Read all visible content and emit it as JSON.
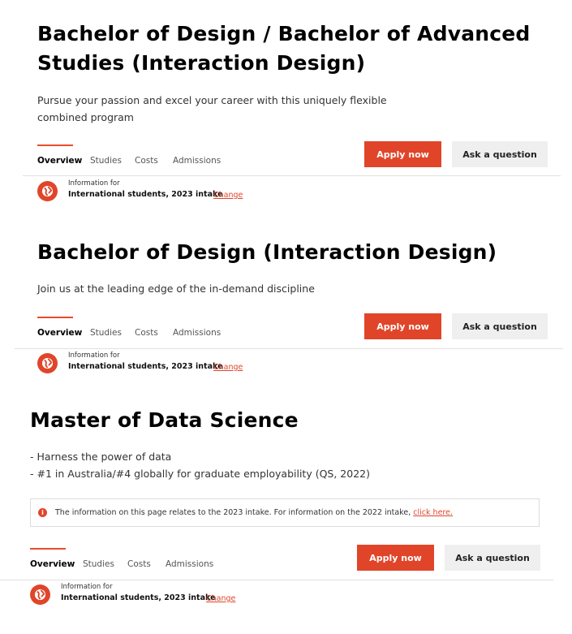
{
  "programs": [
    {
      "title_line1": "Bachelor of Design / Bachelor of Advanced",
      "title_line2": "Studies (Interaction Design)",
      "subtitle_line1": "Pursue your passion and excel your career with this uniquely flexible",
      "subtitle_line2": "combined program",
      "tabs": [
        "Overview",
        "Studies",
        "Costs",
        "Admissions"
      ],
      "apply_label": "Apply now",
      "ask_label": "Ask a question",
      "info_label": "Information for",
      "info_value": "International students, 2023 intake",
      "change_label": "Change"
    },
    {
      "title_line1": "Bachelor of Design (Interaction Design)",
      "subtitle_line1": "Join us at the leading edge of the in-demand discipline",
      "tabs": [
        "Overview",
        "Studies",
        "Costs",
        "Admissions"
      ],
      "apply_label": "Apply now",
      "ask_label": "Ask a question",
      "info_label": "Information for",
      "info_value": "International students, 2023 intake",
      "change_label": "Change"
    },
    {
      "title_line1": "Master of Data Science",
      "subtitle_line1": "- Harness the power of data",
      "subtitle_line2": "- #1 in Australia/#4 globally for graduate employability (QS, 2022)",
      "notice_text": "The information on this page relates to the 2023 intake. For information on the 2022 intake,",
      "notice_link": "click here.",
      "tabs": [
        "Overview",
        "Studies",
        "Costs",
        "Admissions"
      ],
      "apply_label": "Apply now",
      "ask_label": "Ask a question",
      "info_label": "Information for",
      "info_value": "International students, 2023 intake",
      "change_label": "Change"
    }
  ],
  "icons": {
    "globe": "globe-icon",
    "info": "info-icon"
  },
  "colors": {
    "accent": "#e0452a",
    "secondary_button": "#efefef",
    "divider": "#e1e1e1"
  }
}
